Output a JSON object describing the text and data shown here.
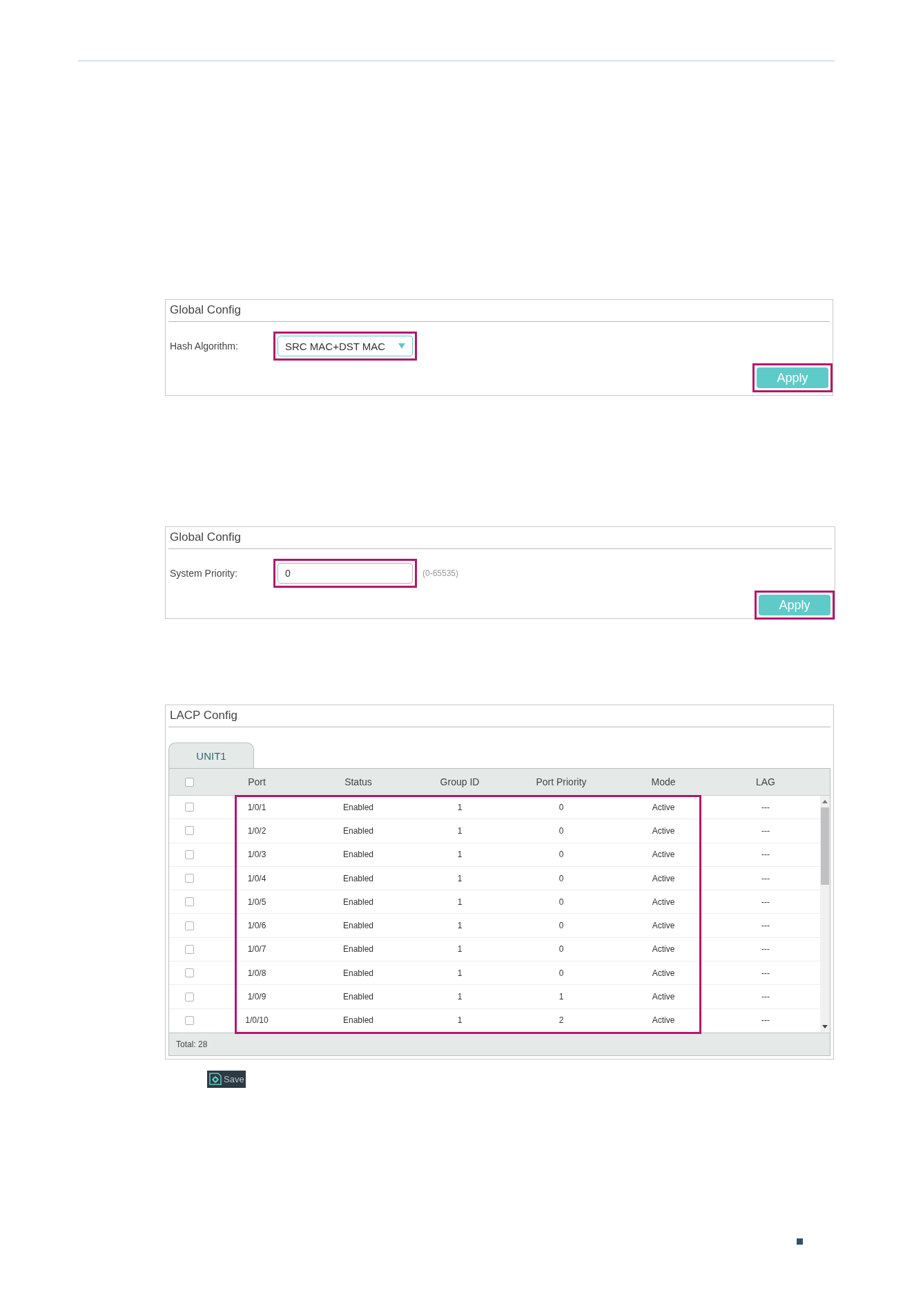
{
  "hash_panel": {
    "title": "Global Config",
    "label": "Hash Algorithm:",
    "select": {
      "value": "SRC MAC+DST MAC",
      "callout": true
    },
    "apply": {
      "label": "Apply",
      "callout": true
    }
  },
  "priority_panel": {
    "title": "Global Config",
    "label": "System Priority:",
    "input": {
      "value": "0",
      "callout": true
    },
    "hint": "(0-65535)",
    "apply": {
      "label": "Apply",
      "callout": true
    }
  },
  "lacp_panel": {
    "title": "LACP Config",
    "tabs": [
      {
        "label": "UNIT1",
        "selected": true
      }
    ],
    "select_all": {
      "checked": false
    },
    "columns": [
      "Port",
      "Status",
      "Group ID",
      "Port Priority",
      "Mode",
      "LAG"
    ],
    "callout": true,
    "rows": [
      {
        "checked": false,
        "cells": [
          "1/0/1",
          "Enabled",
          "1",
          "0",
          "Active",
          "---"
        ]
      },
      {
        "checked": false,
        "cells": [
          "1/0/2",
          "Enabled",
          "1",
          "0",
          "Active",
          "---"
        ]
      },
      {
        "checked": false,
        "cells": [
          "1/0/3",
          "Enabled",
          "1",
          "0",
          "Active",
          "---"
        ]
      },
      {
        "checked": false,
        "cells": [
          "1/0/4",
          "Enabled",
          "1",
          "0",
          "Active",
          "---"
        ]
      },
      {
        "checked": false,
        "cells": [
          "1/0/5",
          "Enabled",
          "1",
          "0",
          "Active",
          "---"
        ]
      },
      {
        "checked": false,
        "cells": [
          "1/0/6",
          "Enabled",
          "1",
          "0",
          "Active",
          "---"
        ]
      },
      {
        "checked": false,
        "cells": [
          "1/0/7",
          "Enabled",
          "1",
          "0",
          "Active",
          "---"
        ]
      },
      {
        "checked": false,
        "cells": [
          "1/0/8",
          "Enabled",
          "1",
          "0",
          "Active",
          "---"
        ]
      },
      {
        "checked": false,
        "cells": [
          "1/0/9",
          "Enabled",
          "1",
          "1",
          "Active",
          "---"
        ]
      },
      {
        "checked": false,
        "cells": [
          "1/0/10",
          "Enabled",
          "1",
          "2",
          "Active",
          "---"
        ]
      }
    ],
    "total": "Total: 28"
  },
  "save_button": {
    "label": "Save"
  }
}
